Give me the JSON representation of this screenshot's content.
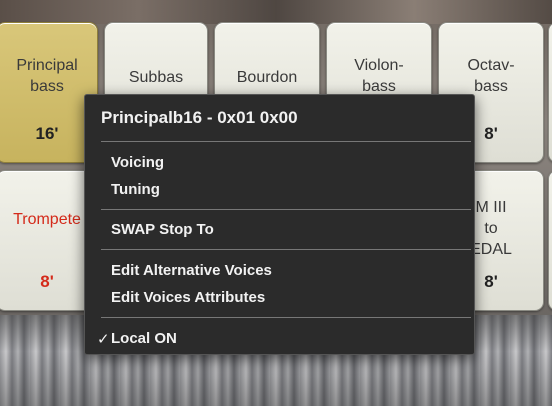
{
  "stops_row1": [
    {
      "name": "Principal\nbass",
      "feet": "16'",
      "active": true
    },
    {
      "name": "Subbas",
      "feet": ""
    },
    {
      "name": "Bourdon",
      "feet": ""
    },
    {
      "name": "Violon-\nbass",
      "feet": ""
    },
    {
      "name": "Octav-\nbass",
      "feet": "8'"
    }
  ],
  "stops_row2": [
    {
      "name": "Trompete",
      "feet": "8'"
    },
    {
      "name": "M III\nto\nEDAL",
      "feet": "8'"
    }
  ],
  "context_menu": {
    "title": "Principalb16 - 0x01 0x00",
    "items": {
      "voicing": "Voicing",
      "tuning": "Tuning",
      "swap": "SWAP Stop To",
      "edit_alt": "Edit Alternative Voices",
      "edit_attr": "Edit Voices Attributes",
      "local_on": "Local ON"
    },
    "checkmark": "✓"
  }
}
